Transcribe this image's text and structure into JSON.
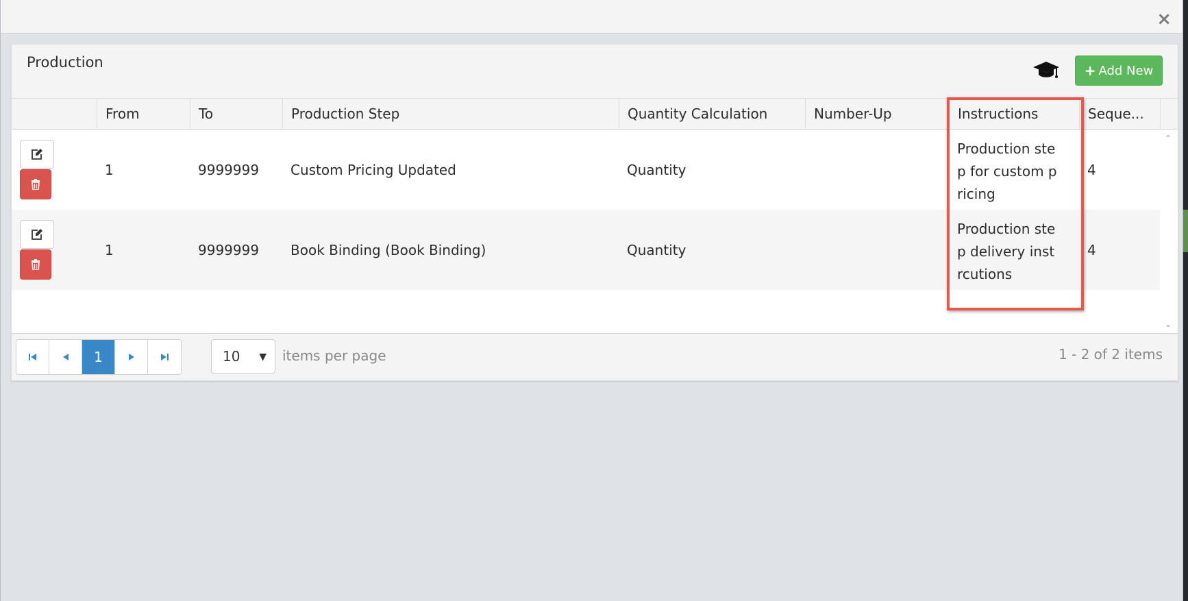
{
  "dialog": {
    "close_label": "×"
  },
  "panel": {
    "title": "Production",
    "add_button_label": "Add New",
    "add_button_icon": "plus-icon",
    "help_icon": "graduation-cap-icon"
  },
  "grid": {
    "columns": [
      "",
      "From",
      "To",
      "Production Step",
      "Quantity Calculation",
      "Number-Up",
      "Instructions",
      "Seque..."
    ],
    "rows": [
      {
        "from": "1",
        "to": "9999999",
        "production_step": "Custom Pricing Updated",
        "quantity_calculation": "Quantity",
        "number_up": "",
        "instructions": "Production step for custom pricing",
        "sequence": "4"
      },
      {
        "from": "1",
        "to": "9999999",
        "production_step": "Book Binding (Book Binding)",
        "quantity_calculation": "Quantity",
        "number_up": "",
        "instructions": "Production step delivery instrcutions",
        "sequence": "4"
      }
    ],
    "row_action_icons": [
      "edit-icon",
      "trash-icon"
    ]
  },
  "pager": {
    "current_page": "1",
    "page_size": "10",
    "items_per_page_label": "items per page",
    "item_count_text": "1 - 2 of 2 items"
  },
  "colors": {
    "add_button": "#5cb85c",
    "delete_button": "#d9534f",
    "active_page": "#3a87c8",
    "highlight_box": "#e8574a"
  }
}
